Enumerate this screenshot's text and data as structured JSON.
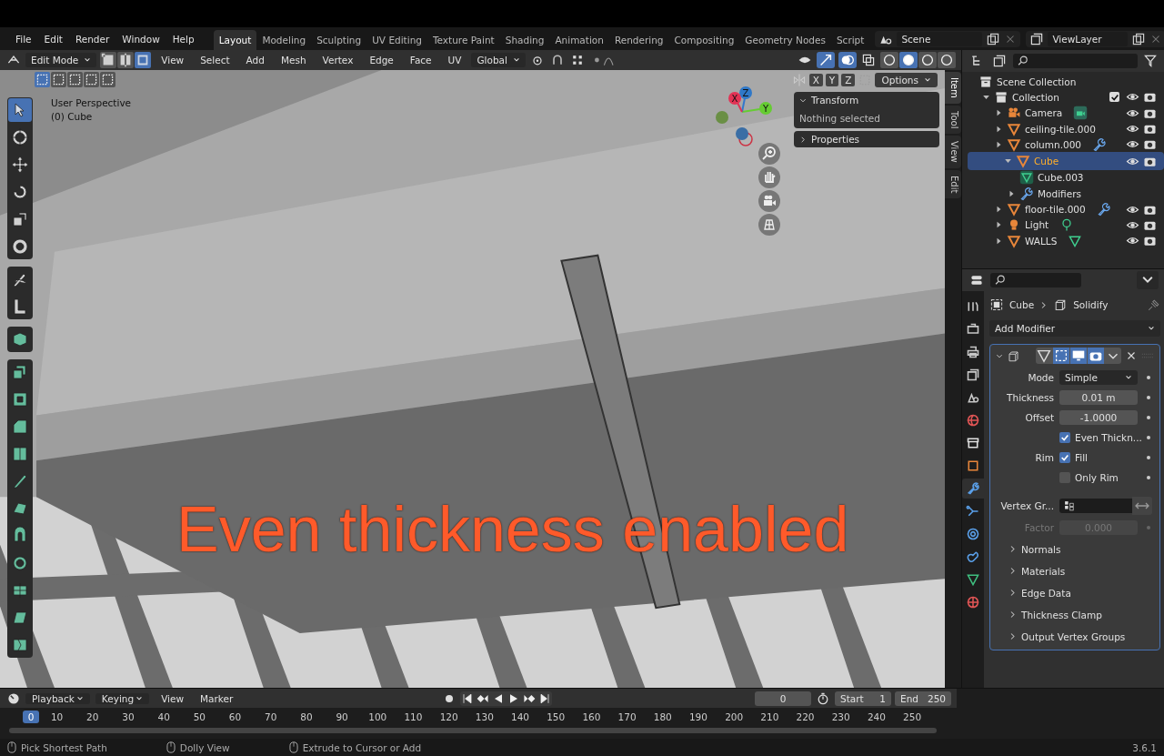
{
  "menu": [
    "File",
    "Edit",
    "Render",
    "Window",
    "Help"
  ],
  "workspaces": [
    {
      "label": "Layout",
      "selected": true
    },
    {
      "label": "Modeling",
      "selected": false
    },
    {
      "label": "Sculpting",
      "selected": false
    },
    {
      "label": "UV Editing",
      "selected": false
    },
    {
      "label": "Texture Paint",
      "selected": false
    },
    {
      "label": "Shading",
      "selected": false
    },
    {
      "label": "Animation",
      "selected": false
    },
    {
      "label": "Rendering",
      "selected": false
    },
    {
      "label": "Compositing",
      "selected": false
    },
    {
      "label": "Geometry Nodes",
      "selected": false
    },
    {
      "label": "Script",
      "selected": false
    }
  ],
  "scene": "Scene",
  "view_layer": "ViewLayer",
  "viewport_header": {
    "mode": "Edit Mode",
    "select_modes": [
      {
        "kind": "vertex",
        "selected": false
      },
      {
        "kind": "edge",
        "selected": false
      },
      {
        "kind": "face",
        "selected": true
      }
    ],
    "menus": [
      "View",
      "Select",
      "Add",
      "Mesh",
      "Vertex",
      "Edge",
      "Face",
      "UV"
    ],
    "orientation": "Global",
    "shading_modes": [
      {
        "kind": "wireframe",
        "selected": false
      },
      {
        "kind": "solid",
        "selected": true
      },
      {
        "kind": "material",
        "selected": false
      },
      {
        "kind": "rendered",
        "selected": false
      }
    ]
  },
  "tool_header": {
    "box_modes": [
      {
        "selected": true
      },
      {
        "selected": false
      },
      {
        "selected": false
      },
      {
        "selected": false
      },
      {
        "selected": false
      }
    ],
    "mirror_axes": [
      {
        "label": "X",
        "selected": false
      },
      {
        "label": "Y",
        "selected": false
      },
      {
        "label": "Z",
        "selected": false
      }
    ],
    "options": "Options"
  },
  "viewport": {
    "view_name": "User Perspective",
    "object": "(0) Cube",
    "annotation": "Even thickness enabled",
    "gizmo_axes": [
      "X",
      "Y",
      "Z"
    ]
  },
  "tool_groups": [
    [
      {
        "kind": "select",
        "selected": true
      },
      {
        "kind": "cursor",
        "selected": false
      },
      {
        "kind": "move",
        "selected": false
      },
      {
        "kind": "rotate",
        "selected": false
      },
      {
        "kind": "scale",
        "selected": false
      },
      {
        "kind": "transform",
        "selected": false
      }
    ],
    [
      {
        "kind": "annotate",
        "selected": false
      },
      {
        "kind": "measure",
        "selected": false
      }
    ],
    [
      {
        "kind": "add_cube",
        "selected": false
      }
    ],
    [
      {
        "kind": "extrude",
        "selected": false
      },
      {
        "kind": "inset",
        "selected": false
      },
      {
        "kind": "bevel",
        "selected": false
      },
      {
        "kind": "loop_cut",
        "selected": false
      },
      {
        "kind": "knife",
        "selected": false
      },
      {
        "kind": "poly_build",
        "selected": false
      },
      {
        "kind": "spin",
        "selected": false
      },
      {
        "kind": "smooth",
        "selected": false
      },
      {
        "kind": "shrink",
        "selected": false
      },
      {
        "kind": "shear",
        "selected": false
      },
      {
        "kind": "rip",
        "selected": false
      }
    ]
  ],
  "n_panel": {
    "panels": [
      {
        "title": "Transform",
        "expanded": true,
        "body": "Nothing selected"
      },
      {
        "title": "Properties",
        "expanded": false
      }
    ],
    "tabs": [
      {
        "label": "Item",
        "selected": true
      },
      {
        "label": "Tool",
        "selected": false
      },
      {
        "label": "View",
        "selected": false
      },
      {
        "label": "Edit",
        "selected": false
      }
    ]
  },
  "outliner": {
    "root": "Scene Collection",
    "items": [
      {
        "name": "Collection",
        "kind": "collection",
        "expanded": true,
        "selected": false,
        "checked": true,
        "visible": true,
        "children": [
          {
            "name": "Camera",
            "kind": "camera",
            "data": {
              "kind": "camera"
            },
            "expanded": false,
            "selected": false,
            "visible": true
          },
          {
            "name": "ceiling-tile.000",
            "kind": "mesh",
            "expanded": false,
            "selected": false,
            "visible": true
          },
          {
            "name": "column.000",
            "kind": "mesh",
            "data": {
              "kind": "modifier"
            },
            "expanded": false,
            "selected": false,
            "visible": true
          },
          {
            "name": "Cube",
            "kind": "mesh",
            "expanded": true,
            "selected": true,
            "visible": true,
            "children": [
              {
                "name": "Cube.003",
                "kind": "meshdata",
                "selected": false
              },
              {
                "name": "Modifiers",
                "kind": "modifiers",
                "expanded": false,
                "selected": false
              }
            ]
          },
          {
            "name": "floor-tile.000",
            "kind": "mesh",
            "data": {
              "kind": "modifier"
            },
            "expanded": false,
            "selected": false,
            "visible": true
          },
          {
            "name": "Light",
            "kind": "light",
            "data": {
              "kind": "light"
            },
            "expanded": false,
            "selected": false,
            "visible": true
          },
          {
            "name": "WALLS",
            "kind": "mesh",
            "data": {
              "kind": "mesh"
            },
            "expanded": false,
            "selected": false,
            "visible": true
          }
        ]
      }
    ]
  },
  "properties": {
    "tabs": [
      {
        "kind": "tool",
        "selected": false
      },
      {
        "kind": "render",
        "selected": false
      },
      {
        "kind": "output",
        "selected": false
      },
      {
        "kind": "view_layer",
        "selected": false
      },
      {
        "kind": "scene",
        "selected": false
      },
      {
        "kind": "world",
        "selected": false
      },
      {
        "kind": "collection",
        "selected": false
      },
      {
        "kind": "object",
        "selected": false
      },
      {
        "kind": "modifiers",
        "selected": true
      },
      {
        "kind": "particles",
        "selected": false
      },
      {
        "kind": "physics",
        "selected": false
      },
      {
        "kind": "constraints",
        "selected": false
      },
      {
        "kind": "data",
        "selected": false
      },
      {
        "kind": "material",
        "selected": false
      }
    ],
    "breadcrumb": [
      "Cube",
      "Solidify"
    ],
    "add_modifier": "Add Modifier",
    "modifier": {
      "expanded": true,
      "fields": [
        {
          "kind": "dropdown",
          "label": "Mode",
          "value": "Simple"
        },
        {
          "kind": "number",
          "label": "Thickness",
          "value": "0.01 m"
        },
        {
          "kind": "number",
          "label": "Offset",
          "value": "-1.0000"
        },
        {
          "kind": "checkbox",
          "text": "Even Thickn...",
          "checked": true
        },
        {
          "kind": "checkbox",
          "label": "Rim",
          "text": "Fill",
          "checked": true
        },
        {
          "kind": "checkbox",
          "text": "Only Rim",
          "checked": false
        },
        {
          "kind": "vgroup",
          "label": "Vertex Gr..."
        },
        {
          "kind": "number",
          "label": "Factor",
          "value": "0.000",
          "disabled": true
        }
      ],
      "subpanels": [
        "Normals",
        "Materials",
        "Edge Data",
        "Thickness Clamp",
        "Output Vertex Groups"
      ]
    }
  },
  "timeline": {
    "menus": [
      "Playback",
      "Keying",
      "View",
      "Marker"
    ],
    "current_frame": "0",
    "start_label": "Start",
    "start": "1",
    "end_label": "End",
    "end": "250",
    "playhead": "0",
    "ruler": [
      "10",
      "20",
      "30",
      "40",
      "50",
      "60",
      "70",
      "80",
      "90",
      "100",
      "110",
      "120",
      "130",
      "140",
      "150",
      "160",
      "170",
      "180",
      "190",
      "200",
      "210",
      "220",
      "230",
      "240",
      "250"
    ]
  },
  "status_bar": {
    "hints": [
      "Pick Shortest Path",
      "Dolly View",
      "Extrude to Cursor or Add"
    ],
    "version": "3.6.1"
  }
}
